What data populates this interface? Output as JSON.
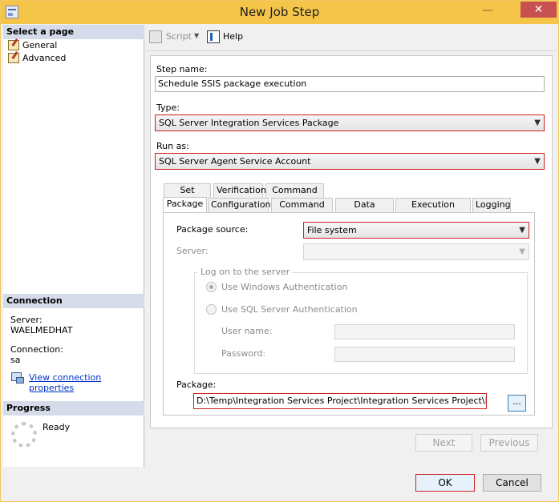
{
  "window": {
    "title": "New Job Step"
  },
  "left": {
    "select_page": "Select a page",
    "pages": [
      "General",
      "Advanced"
    ],
    "connection_header": "Connection",
    "server_label": "Server:",
    "server_value": "WAELMEDHAT",
    "connection_label": "Connection:",
    "connection_value": "sa",
    "view_link": "View connection properties",
    "progress_header": "Progress",
    "progress_status": "Ready"
  },
  "toolbar": {
    "script": "Script",
    "help": "Help"
  },
  "form": {
    "step_name_label": "Step name:",
    "step_name_value": "Schedule SSIS package execution",
    "type_label": "Type:",
    "type_value": "SQL Server Integration Services Package",
    "run_as_label": "Run as:",
    "run_as_value": "SQL Server Agent Service Account"
  },
  "tabs": {
    "row1": [
      "Set values",
      "Verification",
      "Command line"
    ],
    "row2": [
      "Package",
      "Configurations",
      "Command files",
      "Data sources",
      "Execution options",
      "Logging"
    ],
    "active": "Package"
  },
  "package_tab": {
    "package_source_label": "Package source:",
    "package_source_value": "File system",
    "server_label": "Server:",
    "logon_group": "Log on to the server",
    "windows_auth": "Use Windows Authentication",
    "sql_auth": "Use SQL Server Authentication",
    "user_name_label": "User name:",
    "password_label": "Password:",
    "package_label": "Package:",
    "package_path": "D:\\Temp\\Integration Services Project\\Integration Services Project\\Package",
    "browse": "..."
  },
  "buttons": {
    "next": "Next",
    "previous": "Previous",
    "ok": "OK",
    "cancel": "Cancel"
  },
  "colors": {
    "title_bar": "#f5c54a",
    "close": "#c75050",
    "highlight": "#cc2020",
    "section_header": "#d6dbe9",
    "link": "#0033cc"
  }
}
